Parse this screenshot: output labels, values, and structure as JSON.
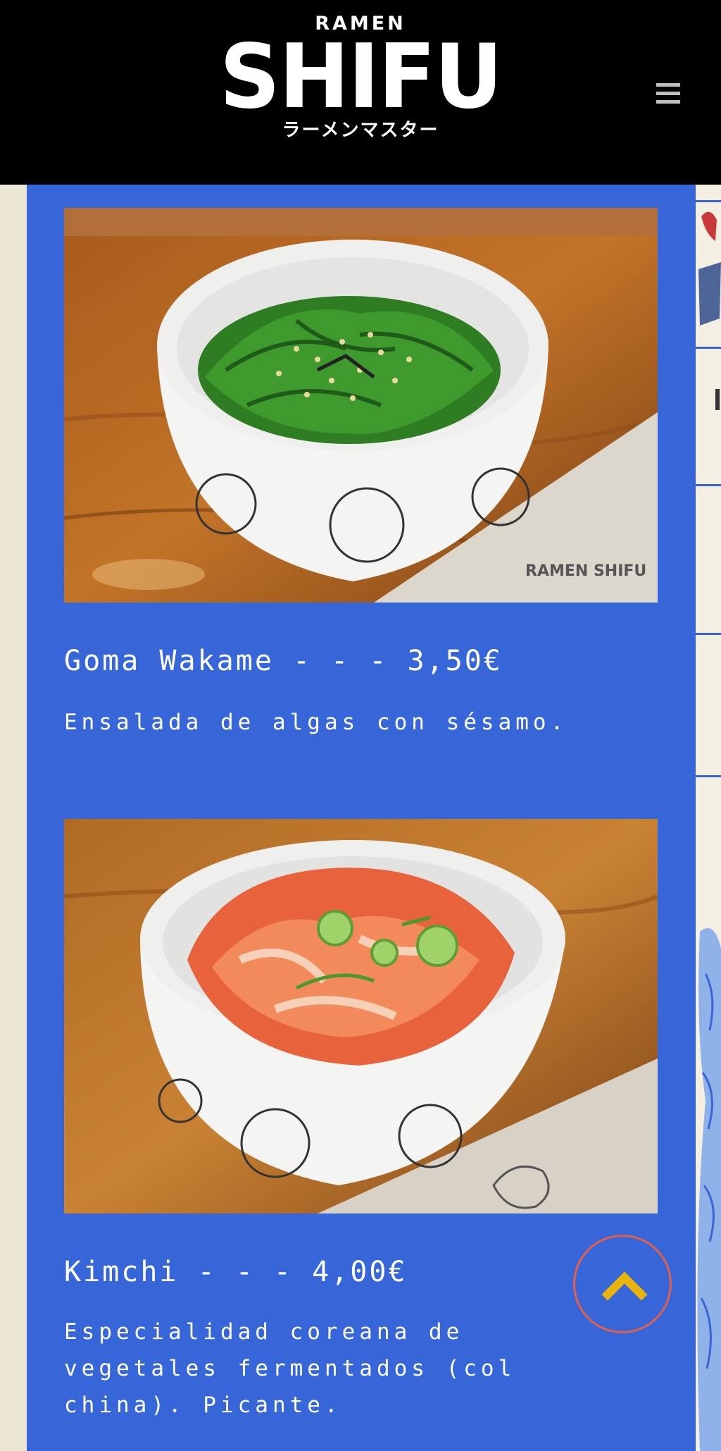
{
  "header": {
    "logo_top": "RAMEN",
    "logo_main": "SHIFU",
    "logo_sub": "ラーメンマスター"
  },
  "icons": {
    "menu": "hamburger-menu-icon",
    "back_to_top": "chevron-up-icon"
  },
  "colors": {
    "header_bg": "#000000",
    "panel_bg": "#3766d8",
    "page_bg": "#ece6d6",
    "arrow": "#e8b40c",
    "button_ring": "#e0604c"
  },
  "menu_items": [
    {
      "title": "Goma Wakame - - - 3,50€",
      "description": "Ensalada de algas con sésamo.",
      "photo_napkin_text": "RAMEN SHIFU"
    },
    {
      "title": "Kimchi - - - 4,00€",
      "description": "Especialidad coreana de vegetales fermentados (col china). Picante."
    }
  ]
}
